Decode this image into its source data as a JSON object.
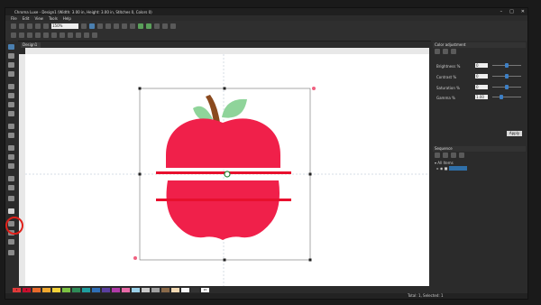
{
  "window": {
    "title": "Chroma Luxe - Design1 (Width: 3.00 in, Height: 3.00 in, Stitches 0, Colors 0)",
    "controls": [
      "–",
      "□",
      "✕"
    ]
  },
  "menu": {
    "items": [
      "File",
      "Edit",
      "View",
      "Tools",
      "Help"
    ]
  },
  "toolbar": {
    "zoom_value": "150%"
  },
  "document_tab": {
    "label": "Design1"
  },
  "color_adjustment": {
    "title": "Color adjustment",
    "rows": [
      {
        "label": "Brightness %",
        "value": "0",
        "level": 0.5
      },
      {
        "label": "Contrast %",
        "value": "0",
        "level": 0.5
      },
      {
        "label": "Saturation %",
        "value": "0",
        "level": 0.5
      },
      {
        "label": "Gamma %",
        "value": "1.00",
        "level": 0.3
      }
    ],
    "apply_label": "Apply"
  },
  "sequence": {
    "title": "Sequence",
    "all_items": "All Items",
    "selected_item": "                "
  },
  "palette": {
    "swatches": [
      {
        "label": "1",
        "color": "#e03a3a"
      },
      {
        "label": "2",
        "color": "#c8102e"
      },
      {
        "label": "",
        "color": "#e86a2c"
      },
      {
        "label": "",
        "color": "#f0a830"
      },
      {
        "label": "",
        "color": "#f3d23a"
      },
      {
        "label": "",
        "color": "#7cc243"
      },
      {
        "label": "",
        "color": "#2e8b57"
      },
      {
        "label": "",
        "color": "#1e9e9e"
      },
      {
        "label": "",
        "color": "#2f6fb7"
      },
      {
        "label": "",
        "color": "#5a3fa0"
      },
      {
        "label": "",
        "color": "#b03aa8"
      },
      {
        "label": "",
        "color": "#e86aa8"
      },
      {
        "label": "",
        "color": "#9ad0e8"
      },
      {
        "label": "",
        "color": "#c9c9c9"
      },
      {
        "label": "",
        "color": "#a0a0a0"
      },
      {
        "label": "",
        "color": "#8a6a4a"
      },
      {
        "label": "",
        "color": "#f2d9b3"
      },
      {
        "label": "",
        "color": "#f8f8f8"
      },
      {
        "label": "",
        "color": "#333333"
      },
      {
        "label": "20",
        "color": "#ffffff"
      },
      {
        "label": "",
        "color": "#2b2b2b"
      }
    ]
  },
  "status": {
    "text": "Total: 1, Selected: 1"
  },
  "design": {
    "apple_color": "#f0204a",
    "leaf_color": "#8fd49a",
    "stem_color": "#8b4a1e",
    "bar_color": "#e8102e"
  }
}
